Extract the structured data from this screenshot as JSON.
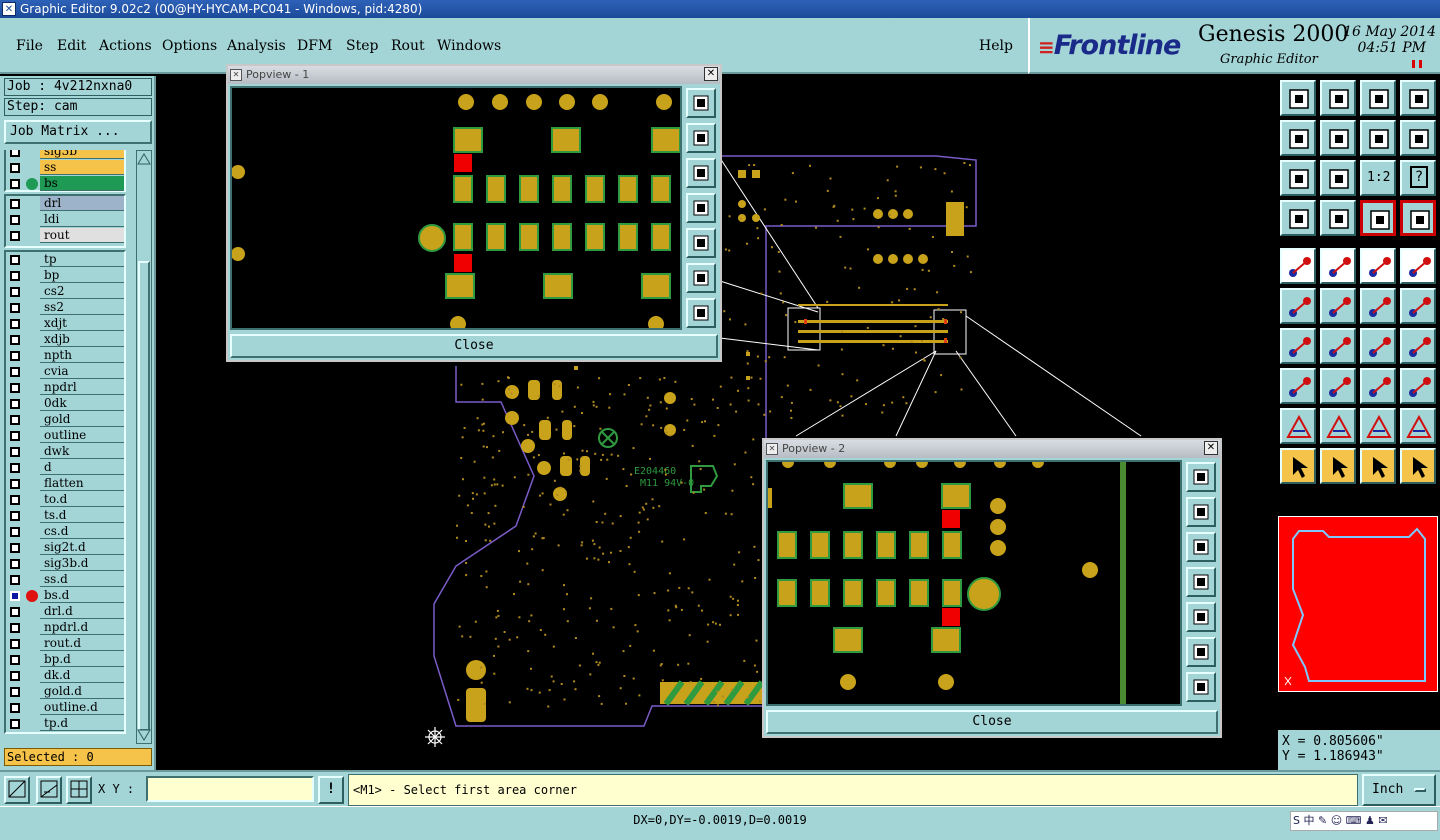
{
  "window": {
    "title": "Graphic Editor 9.02c2 (00@HY-HYCAM-PC041 - Windows, pid:4280)"
  },
  "menu": {
    "file": "File",
    "edit": "Edit",
    "actions": "Actions",
    "options": "Options",
    "analysis": "Analysis",
    "dfm": "DFM",
    "step": "Step",
    "rout": "Rout",
    "windows": "Windows",
    "help": "Help"
  },
  "brand": {
    "logo": "Frontline",
    "product": "Genesis 2000",
    "subtitle": "Graphic Editor",
    "date": "16 May 2014",
    "time": "04:51 PM"
  },
  "job": {
    "job_label": "Job : 4v212nxna0",
    "step_label": "Step: cam",
    "matrix_button": "Job Matrix ..."
  },
  "layers": {
    "group1": [
      {
        "name": "sig3b",
        "color": "#f5c24a",
        "dot": ""
      },
      {
        "name": "ss",
        "color": "#f5c24a",
        "dot": ""
      },
      {
        "name": "bs",
        "color": "#1e9a55",
        "dot": "#1e9a55"
      }
    ],
    "group2": [
      {
        "name": "drl",
        "color": "#9cb3c9",
        "dot": ""
      },
      {
        "name": "ldi",
        "color": "#a3d4d6",
        "dot": ""
      },
      {
        "name": "rout",
        "color": "#e0e0e0",
        "dot": ""
      }
    ],
    "group3": [
      {
        "name": "tp",
        "color": "#a3d4d6",
        "dot": ""
      },
      {
        "name": "bp",
        "color": "#a3d4d6",
        "dot": ""
      },
      {
        "name": "cs2",
        "color": "#a3d4d6",
        "dot": ""
      },
      {
        "name": "ss2",
        "color": "#a3d4d6",
        "dot": ""
      },
      {
        "name": "xdjt",
        "color": "#a3d4d6",
        "dot": ""
      },
      {
        "name": "xdjb",
        "color": "#a3d4d6",
        "dot": ""
      },
      {
        "name": "npth",
        "color": "#a3d4d6",
        "dot": ""
      },
      {
        "name": "cvia",
        "color": "#a3d4d6",
        "dot": ""
      },
      {
        "name": "npdrl",
        "color": "#a3d4d6",
        "dot": ""
      },
      {
        "name": "0dk",
        "color": "#a3d4d6",
        "dot": ""
      },
      {
        "name": "gold",
        "color": "#a3d4d6",
        "dot": ""
      },
      {
        "name": "outline",
        "color": "#a3d4d6",
        "dot": ""
      },
      {
        "name": "dwk",
        "color": "#a3d4d6",
        "dot": ""
      },
      {
        "name": "d",
        "color": "#a3d4d6",
        "dot": ""
      },
      {
        "name": "flatten",
        "color": "#a3d4d6",
        "dot": ""
      },
      {
        "name": "to.d",
        "color": "#a3d4d6",
        "dot": ""
      },
      {
        "name": "ts.d",
        "color": "#a3d4d6",
        "dot": ""
      },
      {
        "name": "cs.d",
        "color": "#a3d4d6",
        "dot": ""
      },
      {
        "name": "sig2t.d",
        "color": "#a3d4d6",
        "dot": ""
      },
      {
        "name": "sig3b.d",
        "color": "#a3d4d6",
        "dot": ""
      },
      {
        "name": "ss.d",
        "color": "#a3d4d6",
        "dot": ""
      },
      {
        "name": "bs.d",
        "color": "#a3d4d6",
        "dot": "#e01010",
        "active": true
      },
      {
        "name": "drl.d",
        "color": "#a3d4d6",
        "dot": ""
      },
      {
        "name": "npdrl.d",
        "color": "#a3d4d6",
        "dot": ""
      },
      {
        "name": "rout.d",
        "color": "#a3d4d6",
        "dot": ""
      },
      {
        "name": "bp.d",
        "color": "#a3d4d6",
        "dot": ""
      },
      {
        "name": "dk.d",
        "color": "#a3d4d6",
        "dot": ""
      },
      {
        "name": "gold.d",
        "color": "#a3d4d6",
        "dot": ""
      },
      {
        "name": "outline.d",
        "color": "#a3d4d6",
        "dot": ""
      },
      {
        "name": "tp.d",
        "color": "#a3d4d6",
        "dot": ""
      }
    ]
  },
  "selected": "Selected : 0",
  "popview1": {
    "title": "Popview - 1",
    "close_label": "Close"
  },
  "popview2": {
    "title": "Popview - 2",
    "close_label": "Close"
  },
  "canvas_text": {
    "marking_top": "E204460",
    "marking_bottom": "M11 94V-0"
  },
  "toolbar": {
    "scale_button": "1:2",
    "help_button": "?"
  },
  "coords": {
    "x": "X = 0.805606\"",
    "y": "Y = 1.186943\""
  },
  "bottom": {
    "xy_label": "X Y :",
    "xy_value": "",
    "bang_label": "!",
    "prompt": "<M1> - Select first area corner",
    "unit": "Inch",
    "status": "DX=0,DY=-0.0019,D=0.0019",
    "tray_text": "S 中 ✎ ☺ ⌨ ♟ ✉"
  },
  "colors": {
    "panel": "#a3d4d6",
    "pad": "#c8a21a",
    "highlight": "#f00000",
    "outline": "#7a5cc8"
  }
}
